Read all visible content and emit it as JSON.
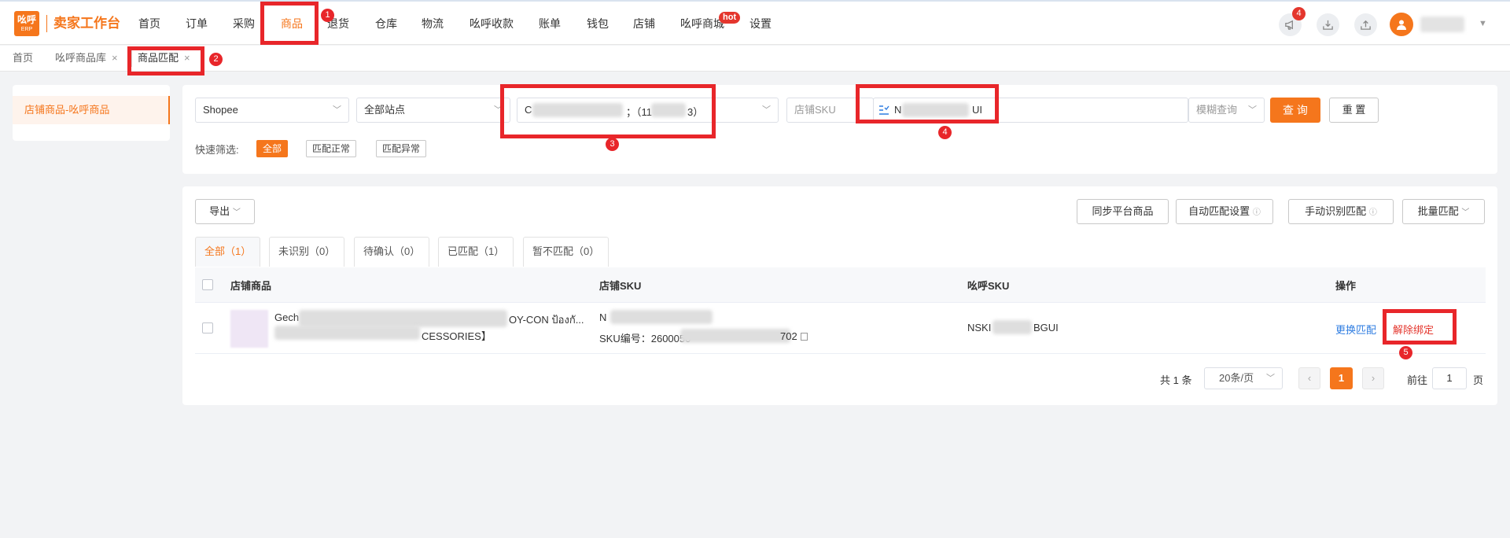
{
  "app": {
    "logo_top": "吆呼",
    "logo_bottom": "ERP",
    "brand": "卖家工作台"
  },
  "nav": {
    "items": [
      "首页",
      "订单",
      "采购",
      "商品",
      "退货",
      "仓库",
      "物流",
      "吆呼收款",
      "账单",
      "钱包",
      "店铺",
      "吆呼商城",
      "设置"
    ],
    "active": "商品",
    "hot_badge": "hot",
    "notification_count": "4"
  },
  "page_tabs": [
    {
      "label": "首页"
    },
    {
      "label": "吆呼商品库",
      "close": "×"
    },
    {
      "label": "商品匹配",
      "close": "×"
    }
  ],
  "sidebar": {
    "items": [
      "店铺商品-吆呼商品"
    ]
  },
  "filters": {
    "platform": "Shopee",
    "site": "全部站点",
    "shop_prefix": "C",
    "shop_suffix": "；（11",
    "shop_end": "3）",
    "sku_type": "店铺SKU",
    "sku_value_prefix": "N",
    "sku_value_suffix": "UI",
    "match_mode": "模糊查询",
    "search_btn": "查 询",
    "reset_btn": "重 置",
    "quick_label": "快速筛选:",
    "quick_options": [
      "全部",
      "匹配正常",
      "匹配异常"
    ]
  },
  "toolbar": {
    "export": "导出",
    "sync": "同步平台商品",
    "auto_match": "自动匹配设置",
    "manual_match": "手动识别匹配",
    "batch_match": "批量匹配"
  },
  "match_tabs": [
    "全部（1）",
    "未识别（0）",
    "待确认（0）",
    "已匹配（1）",
    "暂不匹配（0）"
  ],
  "table": {
    "columns": [
      "店铺商品",
      "店铺SKU",
      "吆呼SKU",
      "操作"
    ],
    "rows": [
      {
        "product_line1_prefix": "Gech",
        "product_line1_suffix": "OY-CON ป้องกั...",
        "product_line2_suffix": "CESSORIES】",
        "shop_sku_line1": "N",
        "shop_sku_line2_prefix": "SKU编号：2600050",
        "shop_sku_line2_suffix": "702",
        "yaohu_sku_prefix": "NSKI",
        "yaohu_sku_suffix": "BGUI",
        "action_change": "更换匹配",
        "action_unbind": "解除绑定"
      }
    ]
  },
  "pagination": {
    "total": "共 1 条",
    "page_size": "20条/页",
    "current": "1",
    "goto_label": "前往",
    "goto_value": "1",
    "page_unit": "页"
  },
  "annotations": [
    "1",
    "2",
    "3",
    "4",
    "5"
  ],
  "colors": {
    "accent": "#f5761c",
    "annotation": "#e8262a",
    "link": "#2f7de1"
  }
}
